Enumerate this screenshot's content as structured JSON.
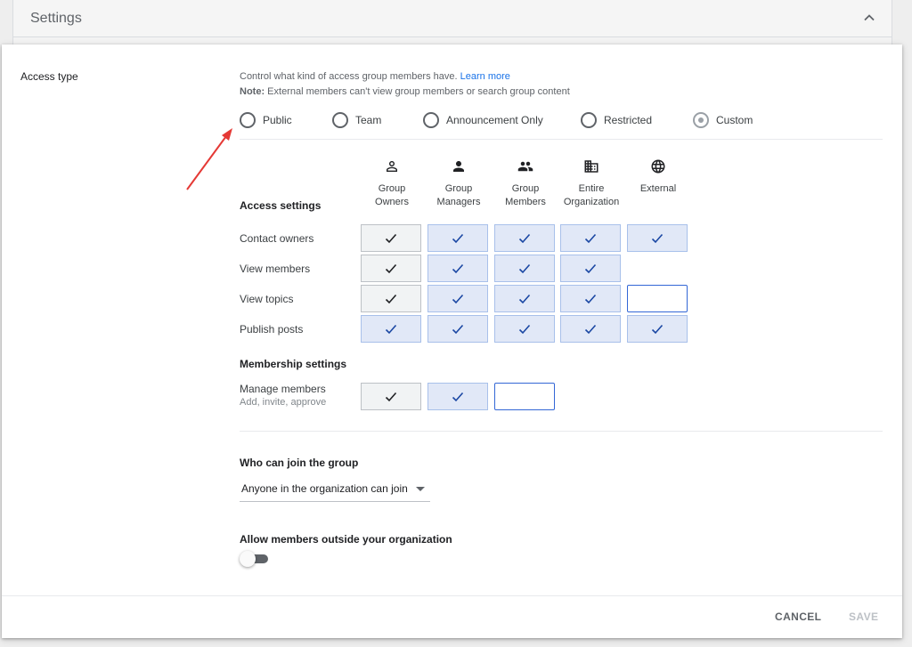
{
  "header": {
    "title": "Settings"
  },
  "access": {
    "label": "Access type",
    "description": "Control what kind of access group members have.",
    "learn_more": "Learn more",
    "note_label": "Note:",
    "note_text": "External members can't view group members or search group content",
    "options": [
      "Public",
      "Team",
      "Announcement Only",
      "Restricted",
      "Custom"
    ],
    "selected": "Custom"
  },
  "columns": [
    {
      "line1": "Group",
      "line2": "Owners",
      "icon": "person-outline-icon"
    },
    {
      "line1": "Group",
      "line2": "Managers",
      "icon": "person-icon"
    },
    {
      "line1": "Group",
      "line2": "Members",
      "icon": "people-icon"
    },
    {
      "line1": "Entire",
      "line2": "Organization",
      "icon": "business-icon"
    },
    {
      "line1": "",
      "line2": "External",
      "icon": "globe-icon"
    }
  ],
  "access_settings": {
    "title": "Access settings",
    "rows": [
      {
        "label": "Contact owners",
        "cells": [
          "checked-grey",
          "checked",
          "checked",
          "checked",
          "checked"
        ]
      },
      {
        "label": "View members",
        "cells": [
          "checked-grey",
          "checked",
          "checked",
          "checked",
          "none"
        ]
      },
      {
        "label": "View topics",
        "cells": [
          "checked-grey",
          "checked",
          "checked",
          "checked",
          "unchecked"
        ]
      },
      {
        "label": "Publish posts",
        "cells": [
          "checked",
          "checked",
          "checked",
          "checked",
          "checked"
        ]
      }
    ]
  },
  "membership_settings": {
    "title": "Membership settings",
    "rows": [
      {
        "label": "Manage members",
        "sublabel": "Add, invite, approve",
        "cells": [
          "checked-grey",
          "checked",
          "unchecked"
        ]
      }
    ]
  },
  "join": {
    "title": "Who can join the group",
    "value": "Anyone in the organization can join"
  },
  "outside": {
    "title": "Allow members outside your organization",
    "enabled": false
  },
  "footer": {
    "cancel": "CANCEL",
    "save": "SAVE"
  },
  "colors": {
    "accent": "#1a73e8",
    "check_blue": "#1a47a3",
    "cell_blue": "#e1e8f7",
    "cell_grey": "#f1f3f4",
    "annotation_arrow": "#e53935"
  }
}
